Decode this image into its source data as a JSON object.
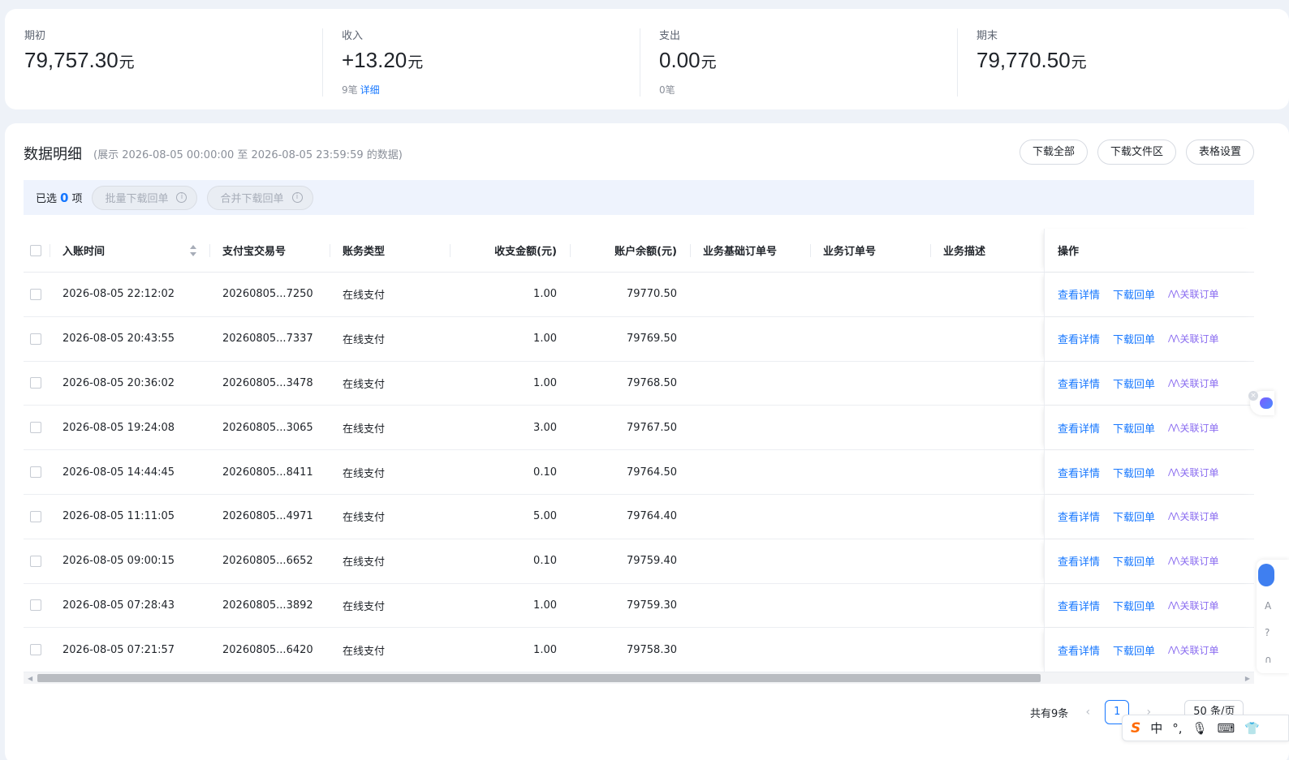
{
  "summary": [
    {
      "label": "期初",
      "value": "79,757.30",
      "unit": "元",
      "sub": "",
      "link": ""
    },
    {
      "label": "收入",
      "value": "+13.20",
      "unit": "元",
      "sub": "9笔",
      "link": "详细"
    },
    {
      "label": "支出",
      "value": "0.00",
      "unit": "元",
      "sub": "0笔",
      "link": ""
    },
    {
      "label": "期末",
      "value": "79,770.50",
      "unit": "元",
      "sub": "",
      "link": ""
    }
  ],
  "detail": {
    "title": "数据明细",
    "range": "(展示 2026-08-05 00:00:00 至 2026-08-05 23:59:59 的数据)",
    "buttons": {
      "download_all": "下载全部",
      "download_files": "下载文件区",
      "table_settings": "表格设置"
    }
  },
  "selection": {
    "prefix": "已选",
    "count": "0",
    "suffix": "项",
    "batch_download": "批量下载回单",
    "merge_download": "合并下载回单"
  },
  "table": {
    "columns": {
      "time": "入账时间",
      "trade_no": "支付宝交易号",
      "type": "账务类型",
      "amount": "收支金额(元)",
      "balance": "账户余额(元)",
      "base_order": "业务基础订单号",
      "order": "业务订单号",
      "desc": "业务描述",
      "ops": "操作"
    },
    "actions": {
      "view": "查看详情",
      "download": "下载回单",
      "link": "关联订单"
    },
    "rows": [
      {
        "time": "2026-08-05 22:12:02",
        "trade_no": "20260805...7250",
        "type": "在线支付",
        "amount": "1.00",
        "balance": "79770.50"
      },
      {
        "time": "2026-08-05 20:43:55",
        "trade_no": "20260805...7337",
        "type": "在线支付",
        "amount": "1.00",
        "balance": "79769.50"
      },
      {
        "time": "2026-08-05 20:36:02",
        "trade_no": "20260805...3478",
        "type": "在线支付",
        "amount": "1.00",
        "balance": "79768.50"
      },
      {
        "time": "2026-08-05 19:24:08",
        "trade_no": "20260805...3065",
        "type": "在线支付",
        "amount": "3.00",
        "balance": "79767.50"
      },
      {
        "time": "2026-08-05 14:44:45",
        "trade_no": "20260805...8411",
        "type": "在线支付",
        "amount": "0.10",
        "balance": "79764.50"
      },
      {
        "time": "2026-08-05 11:11:05",
        "trade_no": "20260805...4971",
        "type": "在线支付",
        "amount": "5.00",
        "balance": "79764.40"
      },
      {
        "time": "2026-08-05 09:00:15",
        "trade_no": "20260805...6652",
        "type": "在线支付",
        "amount": "0.10",
        "balance": "79759.40"
      },
      {
        "time": "2026-08-05 07:28:43",
        "trade_no": "20260805...3892",
        "type": "在线支付",
        "amount": "1.00",
        "balance": "79759.30"
      },
      {
        "time": "2026-08-05 07:21:57",
        "trade_no": "20260805...6420",
        "type": "在线支付",
        "amount": "1.00",
        "balance": "79758.30"
      }
    ]
  },
  "pagination": {
    "total": "共有9条",
    "page": "1",
    "page_size": "50 条/页"
  },
  "ime": {
    "mode": "中"
  }
}
